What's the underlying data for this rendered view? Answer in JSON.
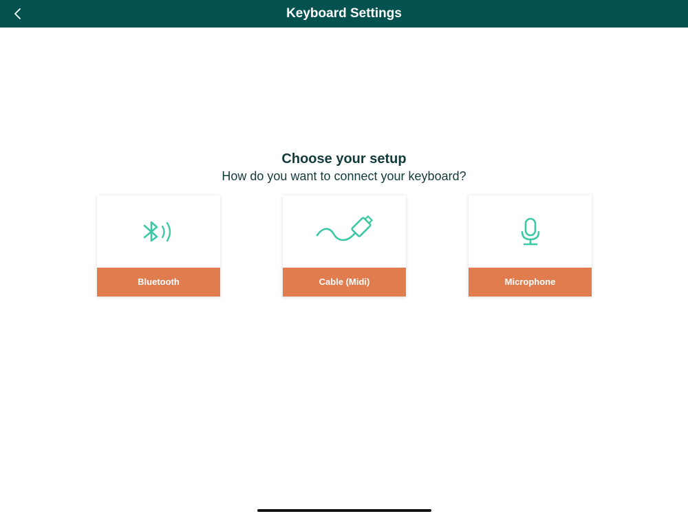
{
  "header": {
    "title": "Keyboard Settings",
    "background": "#03524f",
    "back_icon": "chevron-left-icon"
  },
  "main": {
    "heading": "Choose your setup",
    "subheading": "How do you want to connect your keyboard?"
  },
  "options": [
    {
      "label": "Bluetooth",
      "icon": "bluetooth-icon"
    },
    {
      "label": "Cable (Midi)",
      "icon": "cable-icon"
    },
    {
      "label": "Microphone",
      "icon": "microphone-icon"
    }
  ],
  "colors": {
    "accent": "#e17c4f",
    "icon": "#3cc7a5",
    "text": "#123a3a"
  }
}
